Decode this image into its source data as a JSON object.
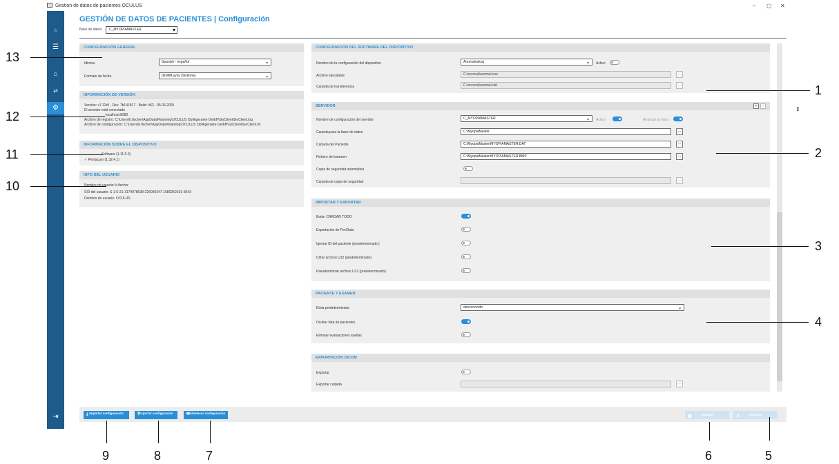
{
  "window": {
    "title": "Gestión de datos de pacientes OCULUS",
    "min": "–",
    "max": "▢",
    "close": "✕"
  },
  "header": {
    "title": "GESTIÓN DE DATOS DE PACIENTES | Configuración",
    "db_label": "Base de datos:",
    "db_value": "C_MYOPIAMASTER"
  },
  "general": {
    "title": "CONFIGURACIÓN GENERAL",
    "language_label": "Idioma",
    "language_value": "Spanish - español",
    "date_label": "Formato de fecha",
    "date_value": "dd.MM.yyyy (Sistema)"
  },
  "version": {
    "title": "INFORMACIÓN DE VERSIÓN",
    "line1": "Versión:  v7.12r0 - Rev. 7b141817 - Build: #62 - 05.06.2025",
    "line2": "El servidor está conectado",
    "line3": "localhost:8080",
    "line4": "Archivo de registro:  C:\\Users\\k.fischer\\AppData\\Roaming\\OCULUS Optikgeraete GmbH\\GoClient\\GoClient.log",
    "line5": "Archivo de configuración:  C:\\Users\\k.fischer\\AppData\\Roaming\\OCULUS Optikgeraete GmbH\\GoClient\\GoClient.ini"
  },
  "device": {
    "title": "INFORMACIÓN SOBRE EL DISPOSITIVO",
    "line1": "Software (1.11.5.0)",
    "line2": "✓  Pentacam (1.32.4.1)"
  },
  "user": {
    "title": "INFO DEL USUARIO",
    "line1": "Nombre de usuario:  k.fischer",
    "line2": "SID del usuario:  S-1-5-21-3174978638-226000247-1580250191-9543",
    "line3": "Dominio de usuario:  OCULUS"
  },
  "software": {
    "title": "CONFIGURACIÓN DEL SOFTWARE DEL DISPOSITIVO",
    "cfg_label": "Nombre de la configuración del dispositivo",
    "cfg_value": "Anomaloskop",
    "active_label": "Activo",
    "exe_label": "Archivo ejecutable",
    "exe_value": "C:\\anomal\\anomal.exe",
    "transfer_label": "Carpeta de transferencia",
    "transfer_value": "C:\\anomal\\anomal.dat",
    "dots": "..."
  },
  "server": {
    "title": "SERVIDOR",
    "name_label": "Nombre de configuración del servidor",
    "name_value": "C_MYOPIAMASTER",
    "active_label": "Activo",
    "startup_label": "Arrancar al inicio",
    "dbfolder_label": "Carpeta para la base de datos",
    "dbfolder_value": "C:\\MyopiaMaster",
    "patient_label": "Carpeta del Paciente",
    "patient_value": "C:\\MyopiaMaster\\MYOPIAMASTER.DAT",
    "exam_label": "Fichero del examen",
    "exam_value": "C:\\MyopiaMaster\\MYOPIAMASTER.BMP",
    "backup_label": "Copia de seguridad automática",
    "backupfolder_label": "Carpeta de copia de seguridad",
    "add": "+",
    "remove": "–"
  },
  "importexport": {
    "title": "IMPORTAR Y EXPORTAR",
    "opt1": "Botón CARGAR TODO",
    "opt2": "Exportación de PeriData",
    "opt3": "Ignorar ID del paciente (predeterminado.)",
    "opt4": "Cifrar archivo U12 (predeterminado)",
    "opt5": "Pseudonimizar archivo U12 (predeterminado)"
  },
  "patientexam": {
    "title": "PACIENTE Y EXAMEN",
    "ethnic_label": "Etnia predeterminada",
    "ethnic_value": "desconocido",
    "hide_label": "Ocultar lista de pacientes",
    "delete_label": "Eliminar evaluaciones sueltas"
  },
  "dicom": {
    "title": "EXPORTACIÓN DICOM",
    "export_label": "Exportar",
    "folder_label": "Exportar carpeta"
  },
  "footer": {
    "import_label": "Importar configuración",
    "export_label": "Exportar configuración",
    "reset_label": "Restablecer configuración",
    "save_label": "Guardar",
    "cancel_label": "Cancelar"
  },
  "callouts": [
    "1",
    "2",
    "3",
    "4",
    "5",
    "6",
    "7",
    "8",
    "9",
    "10",
    "11",
    "12",
    "13"
  ]
}
